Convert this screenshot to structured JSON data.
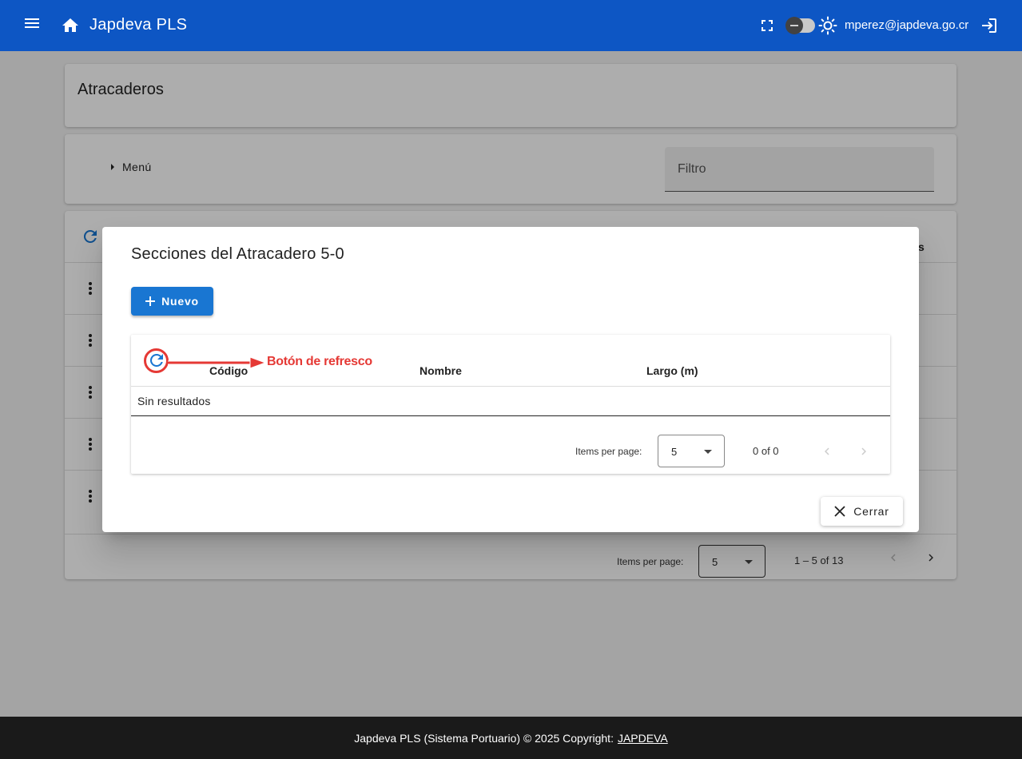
{
  "header": {
    "app_title": "Japdeva PLS",
    "user_email": "mperez@japdeva.go.cr",
    "icons": [
      "menu-icon",
      "home-icon",
      "fullscreen-icon",
      "theme-toggle",
      "sun-icon",
      "logout-icon"
    ],
    "bar_color": "#0d56c4"
  },
  "page": {
    "title": "Atracaderos",
    "menu_label": "Menú",
    "filter_placeholder": "Filtro",
    "table": {
      "partial_header_tail": "s",
      "row_count_visible": 5,
      "paginator": {
        "items_per_page_label": "Items per page:",
        "items_per_page_value": "5",
        "range_label": "1 – 5 of 13"
      }
    }
  },
  "dialog": {
    "title": "Secciones del Atracadero 5-0",
    "new_button_label": "Nuevo",
    "table": {
      "columns": [
        "Código",
        "Nombre",
        "Largo (m)"
      ],
      "empty_text": "Sin resultados",
      "paginator": {
        "items_per_page_label": "Items per page:",
        "items_per_page_value": "5",
        "range_label": "0 of 0"
      }
    },
    "close_button_label": "Cerrar",
    "primary_color": "#1976d2"
  },
  "annotation": {
    "label": "Botón de refresco",
    "color": "#e53935"
  },
  "footer": {
    "text": "Japdeva PLS (Sistema Portuario) © 2025 Copyright:",
    "link_text": "JAPDEVA"
  }
}
